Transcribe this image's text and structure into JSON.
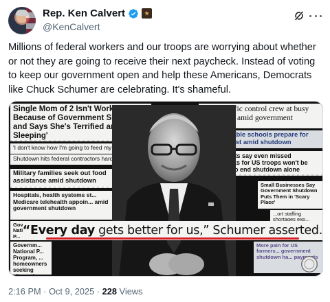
{
  "author": {
    "name": "Rep. Ken Calvert",
    "handle": "@KenCalvert",
    "verified_color": "#1d9bf0"
  },
  "icons": {
    "verified": "verified-badge-icon",
    "gov_badge": "government-affiliation-icon",
    "grok": "grok-icon",
    "more": "more-options-icon"
  },
  "tweet": {
    "text": "Millions of federal workers and our troops are worrying about whether or not they are going to receive their next paycheck. Instead of voting to keep our government open and help these Americans, Democrats like Chuck Schumer are celebrating. It's shameful."
  },
  "image": {
    "headlines": {
      "single_mom": "Single Mom of 2 Isn't Working Because of Government Shutdown and Says She's Terrified and 'Not Sleeping'",
      "feed_kids": "'I don't know how I'm going to feed my kids'",
      "contractors": "Shutdown hits federal contractors hard",
      "military_families": "Military families seek out food assistance amid shutdown",
      "hospitals": "Hospitals, health systems st... Medicare telehealth appoin... amid government shutdown",
      "govt_national": "Governm... National P... Program, ... homeowners seeking alternatives",
      "air_traffic": "No air traffic control crew at busy L... airport amid government shutdown...",
      "vulnerable_schools": "Vulnerable schools prepare for the worst amid shutdown",
      "democrats_missed": "Democrats say even missed paychecks for US troops won't be enough to end shutdown alone",
      "small_business": "Small Businesses Say Government Shutdown Puts Them in 'Scary Place'",
      "staffing": "...ort staffing shortages exp... amid shutd...",
      "more_pain": "More pain for US farmers... government shutdown ha... payments"
    },
    "quote": {
      "part1": "“Every day",
      "part2": " gets better for us,” Schumer asserted."
    }
  },
  "meta": {
    "time": "2:16 PM",
    "date": "Oct 9, 2025",
    "separator": "·",
    "views_count": "228",
    "views_label": "Views"
  }
}
